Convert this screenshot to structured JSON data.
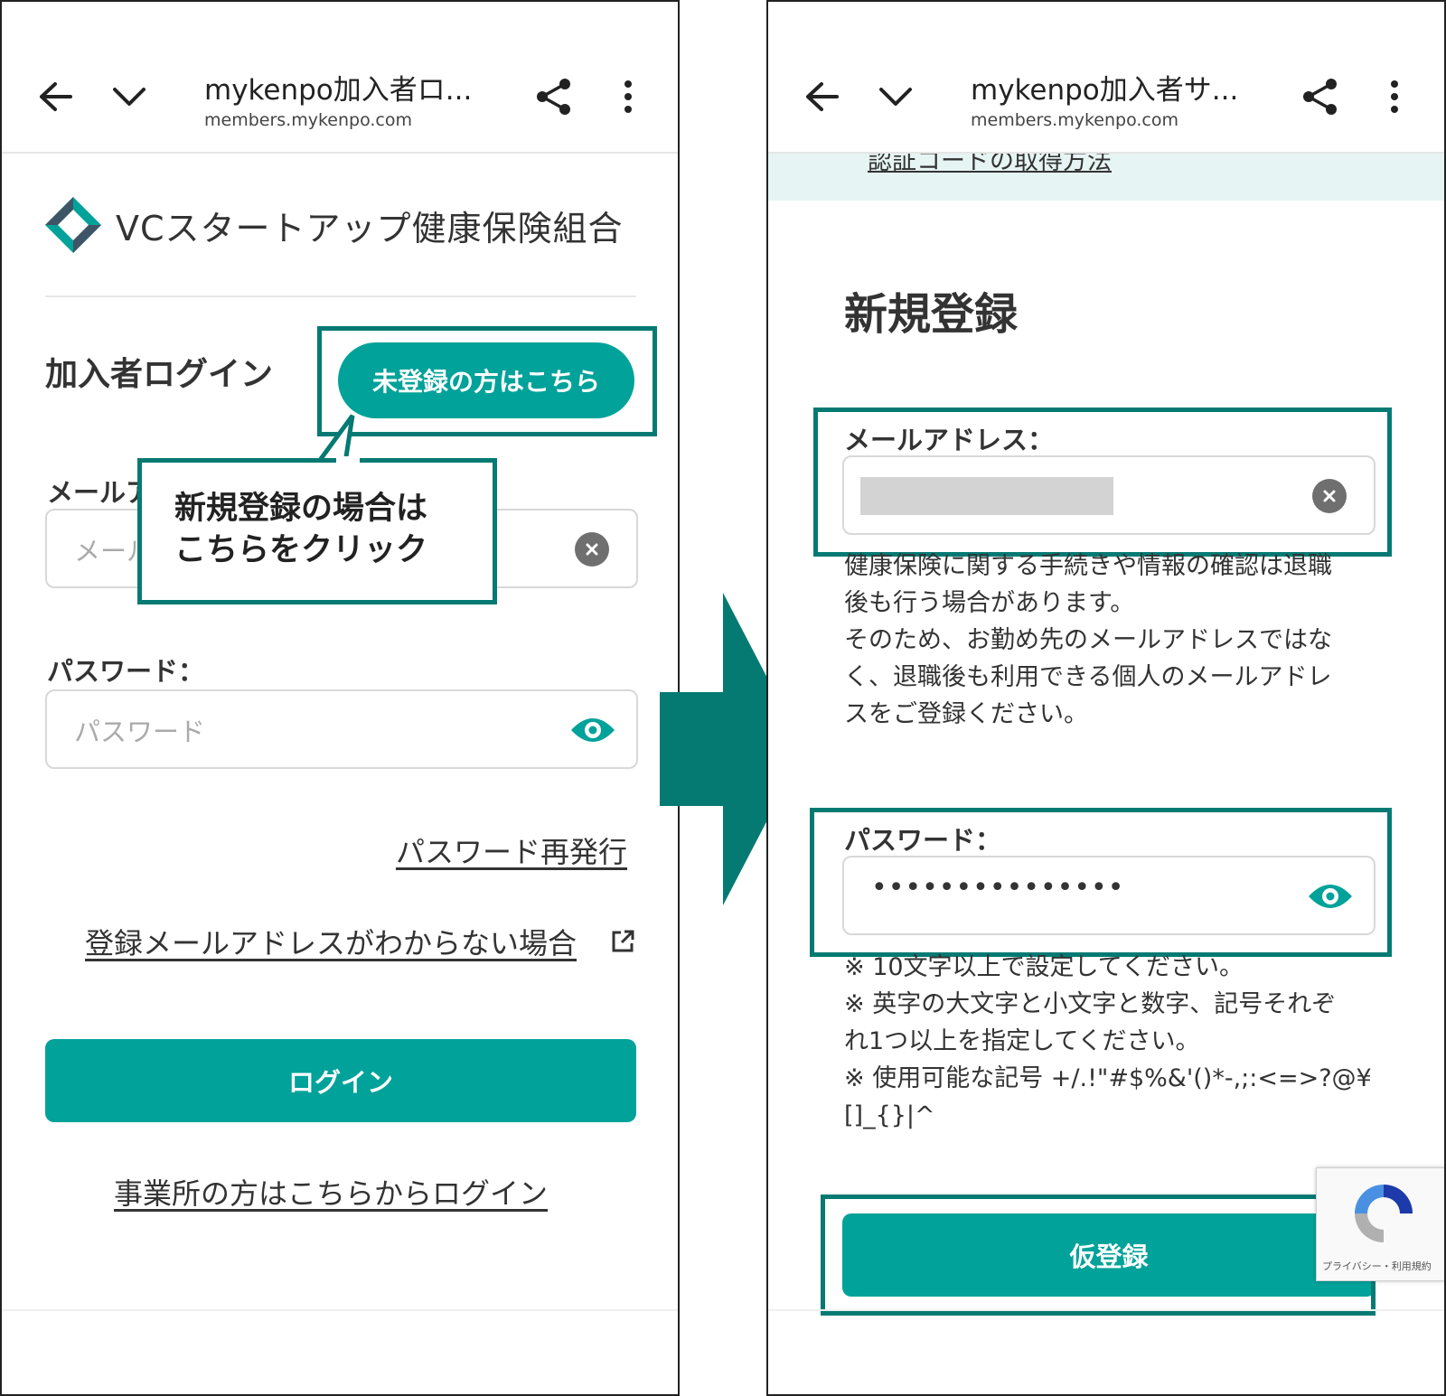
{
  "left": {
    "browser": {
      "title": "mykenpo加入者ロ...",
      "url": "members.mykenpo.com"
    },
    "org_name": "VCスタートアップ健康保険組合",
    "heading": "加入者ログイン",
    "register_button": "未登録の方はこちら",
    "email_label": "メールア",
    "email_placeholder": "メール",
    "password_label": "パスワード：",
    "password_placeholder": "パスワード",
    "reset_link": "パスワード再発行",
    "unknown_email_link": "登録メールアドレスがわからない場合",
    "login_button": "ログイン",
    "office_login_link": "事業所の方はこちらからログイン",
    "callout": {
      "line1": "新規登録の場合は",
      "line2": "こちらをクリック"
    }
  },
  "right": {
    "browser": {
      "title": "mykenpo加入者サ...",
      "url": "members.mykenpo.com"
    },
    "band_link": "認証コードの取得方法",
    "heading": "新規登録",
    "email_label": "メールアドレス：",
    "email_note": [
      "健康保険に関する手続きや情報の確認は退職",
      "後も行う場合があります。",
      "そのため、お勤め先のメールアドレスではな",
      "く、退職後も利用できる個人のメールアドレ",
      "スをご登録ください。"
    ],
    "password_label": "パスワード：",
    "password_value": "•••••••••••••••",
    "password_notes": [
      "※ 10文字以上で設定してください。",
      "※ 英字の大文字と小文字と数字、記号それぞ",
      "れ1つ以上を指定してください。",
      "※ 使用可能な記号 +/.!\"#$%&'()*-,;:<=>?@¥",
      "[]_{}|^"
    ],
    "submit_button": "仮登録",
    "recaptcha_text": "プライバシー・利用規約"
  },
  "colors": {
    "teal": "#00a29a",
    "highlight": "#047a73",
    "arrow": "#047a73"
  }
}
